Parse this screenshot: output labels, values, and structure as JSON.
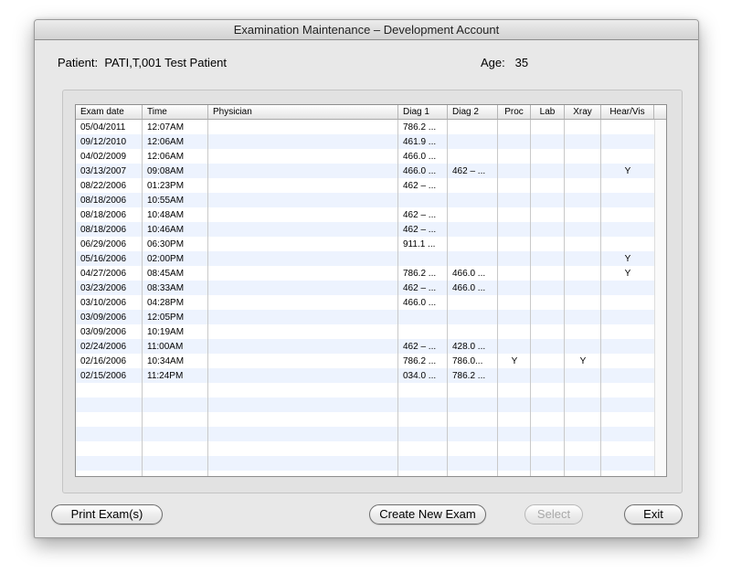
{
  "window": {
    "title": "Examination Maintenance – Development Account"
  },
  "patient": {
    "label": "Patient:",
    "value": "PATI,T,001 Test Patient"
  },
  "age": {
    "label": "Age:",
    "value": "35"
  },
  "table": {
    "columns": [
      "Exam date",
      "Time",
      "Physician",
      "Diag 1",
      "Diag 2",
      "Proc",
      "Lab",
      "Xray",
      "Hear/Vis"
    ],
    "rows": [
      [
        "05/04/2011",
        "12:07AM",
        "",
        "786.2 ...",
        "",
        "",
        "",
        "",
        ""
      ],
      [
        "09/12/2010",
        "12:06AM",
        "",
        "461.9 ...",
        "",
        "",
        "",
        "",
        ""
      ],
      [
        "04/02/2009",
        "12:06AM",
        "",
        "466.0 ...",
        "",
        "",
        "",
        "",
        ""
      ],
      [
        "03/13/2007",
        "09:08AM",
        "",
        "466.0 ...",
        "462 – ...",
        "",
        "",
        "",
        "Y"
      ],
      [
        "08/22/2006",
        "01:23PM",
        "",
        "462 – ...",
        "",
        "",
        "",
        "",
        ""
      ],
      [
        "08/18/2006",
        "10:55AM",
        "",
        "",
        "",
        "",
        "",
        "",
        ""
      ],
      [
        "08/18/2006",
        "10:48AM",
        "",
        "462 – ...",
        "",
        "",
        "",
        "",
        ""
      ],
      [
        "08/18/2006",
        "10:46AM",
        "",
        "462 – ...",
        "",
        "",
        "",
        "",
        ""
      ],
      [
        "06/29/2006",
        "06:30PM",
        "",
        "911.1 ...",
        "",
        "",
        "",
        "",
        ""
      ],
      [
        "05/16/2006",
        "02:00PM",
        "",
        "",
        "",
        "",
        "",
        "",
        "Y"
      ],
      [
        "04/27/2006",
        "08:45AM",
        "",
        "786.2 ...",
        "466.0 ...",
        "",
        "",
        "",
        "Y"
      ],
      [
        "03/23/2006",
        "08:33AM",
        "",
        "462 – ...",
        "466.0 ...",
        "",
        "",
        "",
        ""
      ],
      [
        "03/10/2006",
        "04:28PM",
        "",
        "466.0 ...",
        "",
        "",
        "",
        "",
        ""
      ],
      [
        "03/09/2006",
        "12:05PM",
        "",
        "",
        "",
        "",
        "",
        "",
        ""
      ],
      [
        "03/09/2006",
        "10:19AM",
        "",
        "",
        "",
        "",
        "",
        "",
        ""
      ],
      [
        "02/24/2006",
        "11:00AM",
        "",
        "462 – ...",
        "428.0 ...",
        "",
        "",
        "",
        ""
      ],
      [
        "02/16/2006",
        "10:34AM",
        "",
        "786.2 ...",
        "786.0...",
        "Y",
        "",
        "Y",
        ""
      ],
      [
        "02/15/2006",
        "11:24PM",
        "",
        "034.0 ...",
        "786.2 ...",
        "",
        "",
        "",
        ""
      ]
    ]
  },
  "buttons": {
    "print": "Print Exam(s)",
    "create": "Create New Exam",
    "select": "Select",
    "exit": "Exit"
  }
}
